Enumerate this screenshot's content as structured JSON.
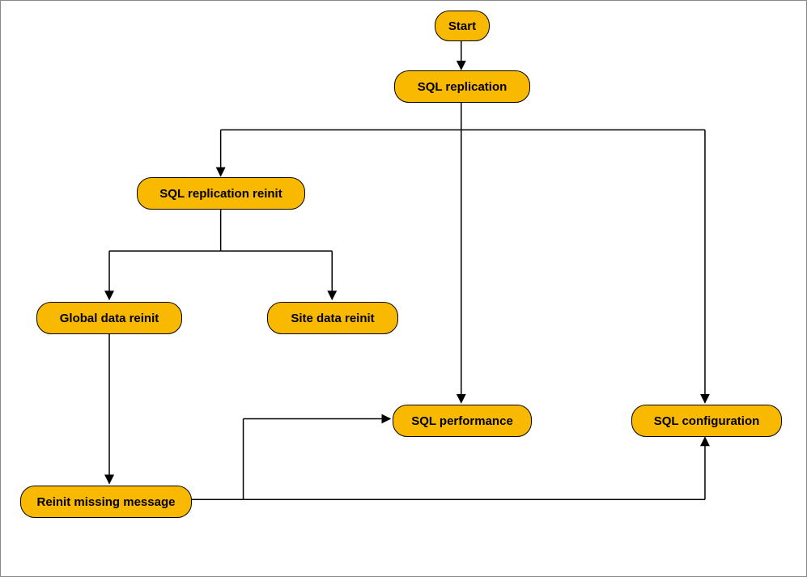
{
  "nodes": {
    "start": "Start",
    "sql_replication": "SQL replication",
    "sql_replication_reinit": "SQL replication reinit",
    "global_data_reinit": "Global data reinit",
    "site_data_reinit": "Site data reinit",
    "reinit_missing_message": "Reinit missing message",
    "sql_performance": "SQL performance",
    "sql_configuration": "SQL configuration"
  },
  "colors": {
    "node_fill": "#f9b900",
    "node_border": "#000000",
    "arrow": "#000000"
  }
}
